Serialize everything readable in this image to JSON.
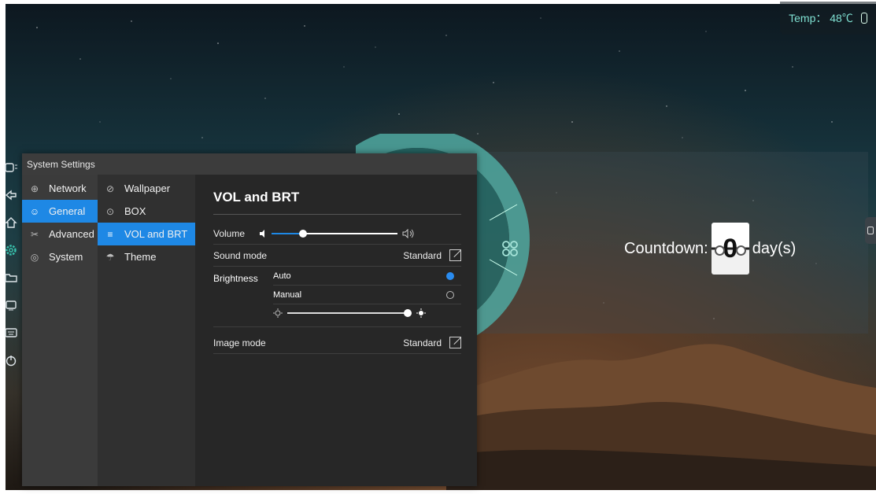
{
  "status": {
    "temp_label": "Temp： 48℃",
    "usb_icon": "usb-icon"
  },
  "countdown": {
    "label": "Countdown:",
    "value": "0",
    "unit": "day(s)"
  },
  "toolbar": {
    "items": [
      {
        "icon": "screen-menu-icon"
      },
      {
        "icon": "back-icon"
      },
      {
        "icon": "home-icon"
      },
      {
        "icon": "settings-gear-icon",
        "active": true
      },
      {
        "icon": "folder-icon"
      },
      {
        "icon": "input-source-icon"
      },
      {
        "icon": "keyboard-icon"
      },
      {
        "icon": "power-icon"
      }
    ]
  },
  "window": {
    "title": "System Settings",
    "categories": [
      {
        "label": "Network",
        "icon": "globe-icon"
      },
      {
        "label": "General",
        "icon": "palette-icon",
        "active": true
      },
      {
        "label": "Advanced",
        "icon": "tools-icon"
      },
      {
        "label": "System",
        "icon": "system-icon"
      }
    ],
    "subitems": [
      {
        "label": "Wallpaper",
        "icon": "wallpaper-icon"
      },
      {
        "label": "BOX",
        "icon": "box-icon"
      },
      {
        "label": "VOL and BRT",
        "icon": "vol-brt-icon",
        "active": true
      },
      {
        "label": "Theme",
        "icon": "shirt-icon"
      }
    ],
    "detail": {
      "title": "VOL and BRT",
      "volume_label": "Volume",
      "volume_level": 0.25,
      "sound_mode_label": "Sound mode",
      "sound_mode_value": "Standard",
      "brightness_label": "Brightness",
      "brightness_auto": "Auto",
      "brightness_manual": "Manual",
      "brightness_selected": "Auto",
      "brightness_level": 0.97,
      "image_mode_label": "Image mode",
      "image_mode_value": "Standard"
    }
  },
  "colors": {
    "accent": "#1e88e5",
    "teal": "#39c6b0",
    "temp_text": "#7fe0d2"
  }
}
